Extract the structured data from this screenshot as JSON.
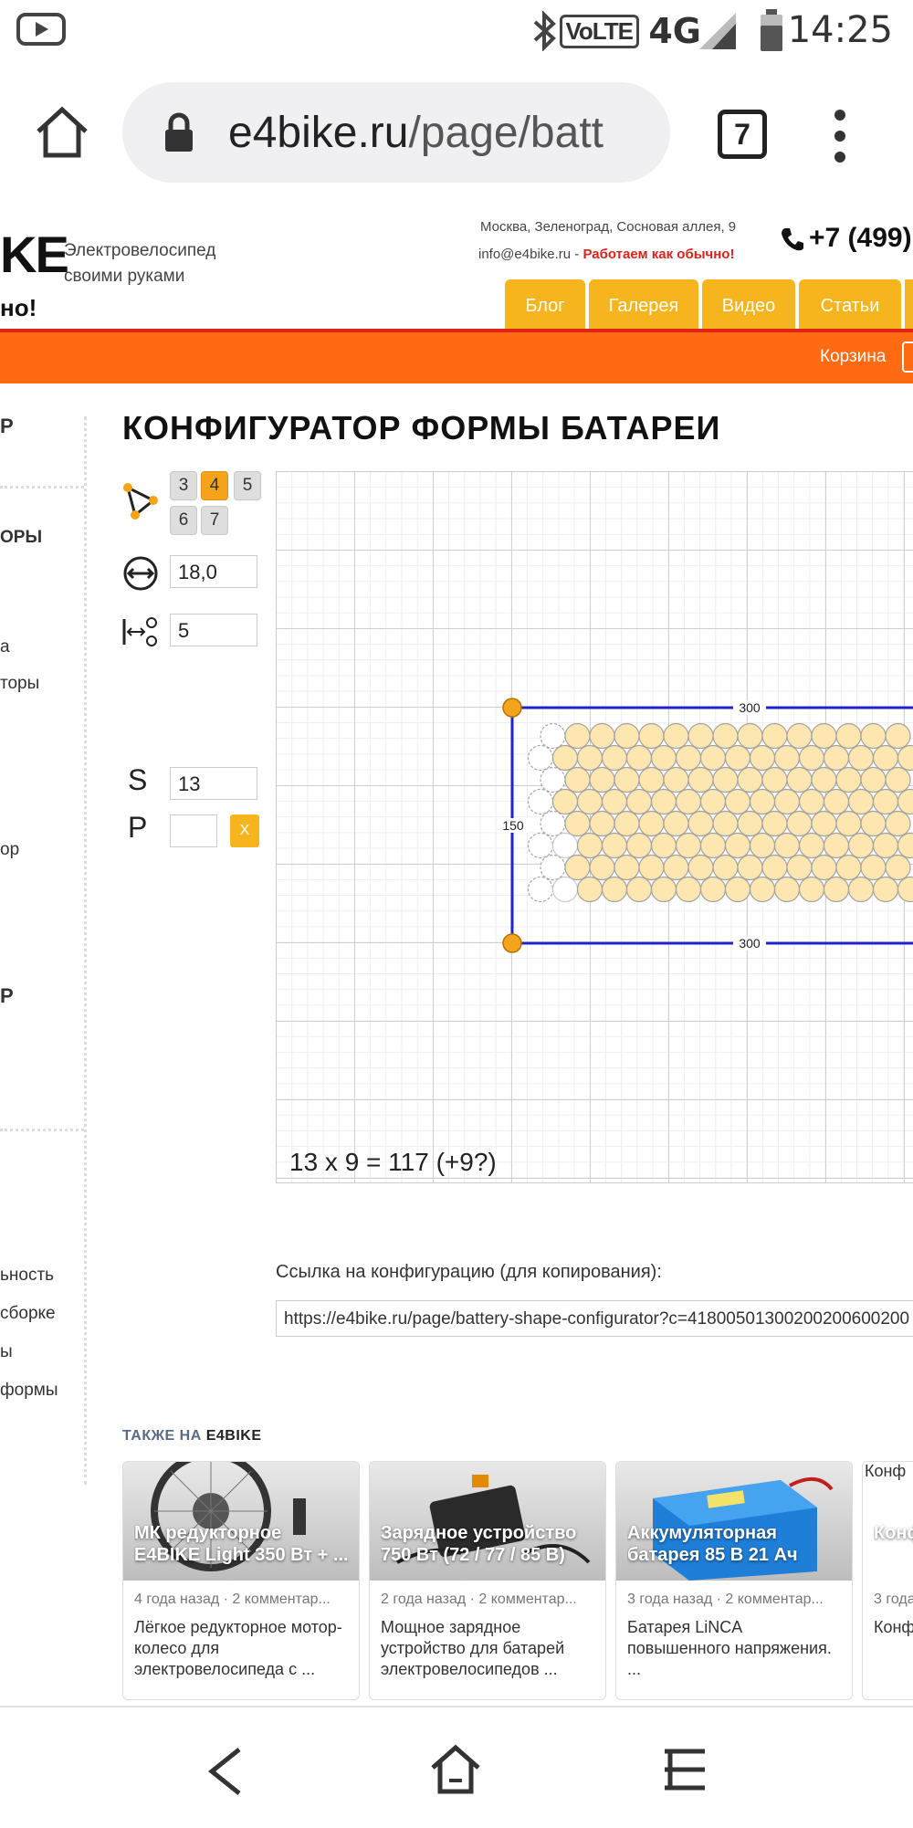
{
  "status_bar": {
    "time": "14:25",
    "network": "4G",
    "network_small": "4G",
    "volte": "VoLTE"
  },
  "browser": {
    "url_domain": "e4bike.ru",
    "url_path": "/page/batt",
    "tab_count": "7"
  },
  "site": {
    "logo_fragment_top": "KE",
    "logo_fragment_bottom": "но!",
    "tagline_line1": "Электровелосипед",
    "tagline_line2": "своими руками",
    "address": "Москва, Зеленоград, Сосновая аллея, 9",
    "email": "info@e4bike.ru",
    "email_sep": " - ",
    "working_notice": "Работаем как обычно!",
    "phone": "+7 (499)",
    "nav": [
      "Блог",
      "Галерея",
      "Видео",
      "Статьи"
    ],
    "cart_label": "Корзина"
  },
  "sidebar": {
    "items": [
      "Р",
      "ОРЫ",
      "а",
      "торы",
      "ор",
      "Р",
      "ьность",
      "сборке",
      "ы",
      "формы"
    ]
  },
  "configurator": {
    "title": "КОНФИГУРАТОР ФОРМЫ БАТАРЕИ",
    "neighbor_options": [
      "3",
      "4",
      "5",
      "6",
      "7"
    ],
    "neighbor_selected": "4",
    "diameter_value": "18,0",
    "gap_value": "5",
    "s_label": "S",
    "s_value": "13",
    "p_label": "P",
    "p_value": "",
    "clear_label": "X",
    "dim_top": "300",
    "dim_bottom": "300",
    "dim_left": "150",
    "formula": "13 x 9 = 117 (+9?)",
    "colors": {
      "cell_fill": "#fde6b0",
      "cell_stroke": "#a3a3a3",
      "frame": "#2222cc",
      "handle": "#f6a31c"
    }
  },
  "link": {
    "label": "Ссылка на конфигурацию (для копирования):",
    "value": "https://e4bike.ru/page/battery-shape-configurator?c=41800501300200200600200"
  },
  "also_on": {
    "title_prefix": "ТАКЖЕ НА ",
    "title_brand": "E4BIKE",
    "cards": [
      {
        "thumb_title_1": "МК редукторное",
        "thumb_title_2": "E4BIKE Light 350 Вт + ...",
        "meta": "4 года назад · 2 комментар...",
        "desc": "Лёгкое редукторное мотор-колесо для электровелосипеда с ..."
      },
      {
        "thumb_title_1": "Зарядное устройство",
        "thumb_title_2": "750 Вт (72 / 77 / 85 В)",
        "meta": "2 года назад · 2 комментар...",
        "desc": "Мощное зарядное устройство для батарей электровелосипедов ..."
      },
      {
        "thumb_title_1": "Аккумуляторная",
        "thumb_title_2": "батарея 85 В 21 Ач",
        "meta": "3 года назад · 2 комментар...",
        "desc": "Батарея LiNCA повышенного напряжения. ..."
      },
      {
        "thumb_title_1": "Конф",
        "thumb_title_2": "",
        "meta": "3 года",
        "desc": "Конф",
        "broken_img_alt": "Конф"
      }
    ]
  }
}
